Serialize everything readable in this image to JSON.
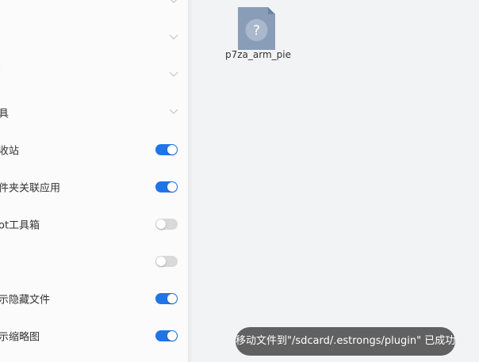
{
  "sidebar": {
    "items": [
      {
        "label": "𝄒",
        "type": "chevron"
      },
      {
        "label": "",
        "type": "chevron"
      },
      {
        "label": "𝄒",
        "type": "chevron"
      },
      {
        "label": "具",
        "type": "chevron"
      },
      {
        "label": "收站",
        "type": "toggle",
        "on": true
      },
      {
        "label": "件夹关联应用",
        "type": "toggle",
        "on": true
      },
      {
        "label": "ot工具箱",
        "type": "toggle",
        "on": false
      },
      {
        "label": "𝄒",
        "type": "toggle",
        "on": false
      },
      {
        "label": "示隐藏文件",
        "type": "toggle",
        "on": true
      },
      {
        "label": "示缩略图",
        "type": "toggle",
        "on": true
      }
    ]
  },
  "main": {
    "file": {
      "name": "p7za_arm_pie",
      "icon": "unknown-file-icon",
      "glyph": "?"
    }
  },
  "toast": {
    "text": "移动文件到\"/sdcard/.estrongs/plugin\" 已成功"
  },
  "colors": {
    "toggle_on": "#1f75e8",
    "toggle_off": "#d9d9d9",
    "file_icon": "#8a9db8"
  }
}
